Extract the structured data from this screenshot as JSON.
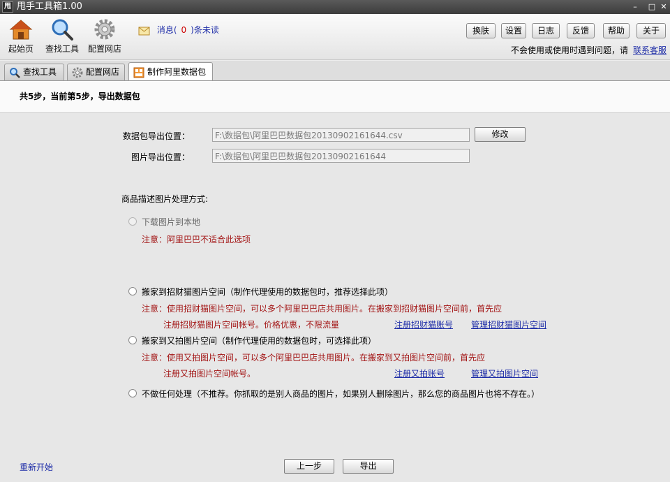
{
  "window": {
    "logo_text": "甩",
    "title": "甩手工具箱1.00",
    "minimize": "–",
    "maximize": "□",
    "close": "✕"
  },
  "toolbar": {
    "home_label": "起始页",
    "find_tools_label": "查找工具",
    "config_shop_label": "配置网店",
    "message_prefix": "消息(",
    "message_count": "0",
    "message_suffix": ")条未读",
    "buttons": {
      "skin": "换肤",
      "settings": "设置",
      "log": "日志",
      "feedback": "反馈",
      "help": "帮助",
      "about": "关于"
    },
    "help_text": "不会使用或使用时遇到问题，请",
    "contact_link": "联系客服"
  },
  "tabs": [
    {
      "label": "查找工具"
    },
    {
      "label": "配置网店"
    },
    {
      "label": "制作阿里数据包"
    }
  ],
  "step": {
    "title": "共5步，当前第5步，导出数据包"
  },
  "export": {
    "package_label": "数据包导出位置：",
    "package_value": "F:\\数据包\\阿里巴巴数据包20130902161644.csv",
    "modify_button": "修改",
    "image_label": "图片导出位置：",
    "image_value": "F:\\数据包\\阿里巴巴数据包20130902161644"
  },
  "image_handling": {
    "label": "商品描述图片处理方式:",
    "opt_download": "下载图片到本地",
    "opt_download_note": "注意：阿里巴巴不适合此选项",
    "opt_zhaocaimao": "搬家到招财猫图片空间（制作代理使用的数据包时，推荐选择此项）",
    "opt_zhaocaimao_note1": "注意：使用招财猫图片空间，可以多个阿里巴巴店共用图片。在搬家到招财猫图片空间前，首先应",
    "opt_zhaocaimao_note2": "注册招财猫图片空间帐号。价格优惠，不限流量",
    "zhaocaimao_register": "注册招财猫账号",
    "zhaocaimao_manage": "管理招财猫图片空间",
    "opt_youpai": "搬家到又拍图片空间（制作代理使用的数据包时，可选择此项）",
    "opt_youpai_note1": "注意：使用又拍图片空间，可以多个阿里巴巴店共用图片。在搬家到又拍图片空间前，首先应",
    "opt_youpai_note2": "注册又拍图片空间帐号。",
    "youpai_register": "注册又拍账号",
    "youpai_manage": "管理又拍图片空间",
    "opt_none": "不做任何处理（不推荐。你抓取的是别人商品的图片，如果别人删除图片，那么您的商品图片也将不存在。）"
  },
  "footer": {
    "restart_link": "重新开始",
    "prev_button": "上一步",
    "export_button": "导出"
  }
}
